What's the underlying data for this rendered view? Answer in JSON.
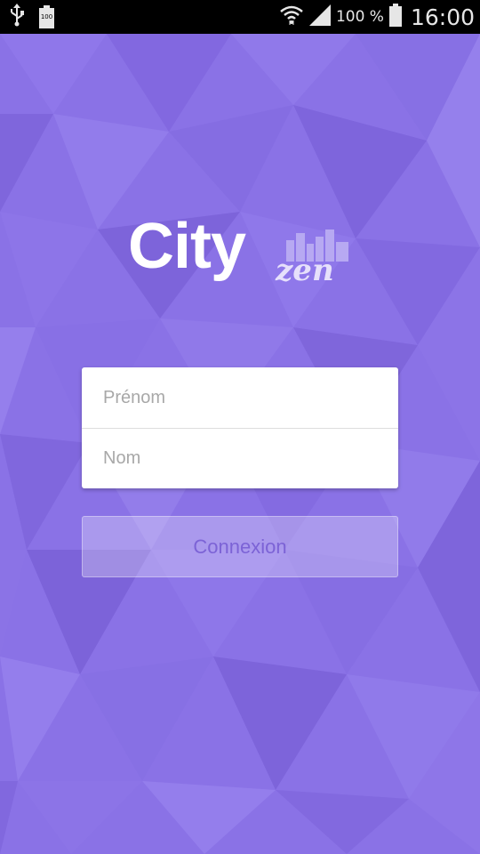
{
  "status_bar": {
    "usb_icon": "usb-icon",
    "battery_small_label": "100",
    "wifi_icon": "wifi-icon",
    "signal_icon": "signal-icon",
    "battery_percent": "100 %",
    "battery_icon": "battery-icon",
    "time": "16:00"
  },
  "logo": {
    "primary": "City",
    "secondary": "zen"
  },
  "login": {
    "first_name_placeholder": "Prénom",
    "last_name_placeholder": "Nom",
    "submit_label": "Connexion"
  },
  "colors": {
    "background": "#8a72e6",
    "button_text": "#7c63d6",
    "status_bar": "#000000"
  }
}
